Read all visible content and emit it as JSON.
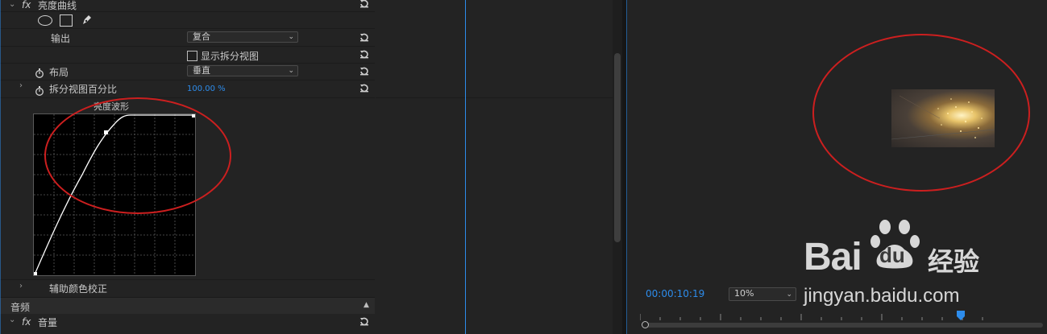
{
  "effects_panel": {
    "luma_curve": {
      "fx_label": "fx",
      "title": "亮度曲线",
      "output_label": "输出",
      "output_value": "复合",
      "split_view_label": "显示拆分视图",
      "split_view_checked": false,
      "layout_label": "布局",
      "layout_value": "垂直",
      "split_percent_label": "拆分视图百分比",
      "split_percent_value": "100.00 %",
      "waveform_title": "亮度波形"
    },
    "secondary_color": {
      "label": "辅助颜色校正"
    },
    "audio_section": {
      "label": "音频"
    },
    "volume": {
      "fx_label": "fx",
      "label": "音量"
    }
  },
  "program_monitor": {
    "timecode": "00:00:10:19",
    "zoom_value": "10%"
  },
  "watermark": {
    "brand": "Bai",
    "brand2": "du",
    "brand_cn": "经验",
    "url": "jingyan.baidu.com"
  },
  "colors": {
    "accent_blue": "#2d8ceb",
    "annotation_red": "#cc1f1f",
    "panel_bg": "#232323"
  }
}
